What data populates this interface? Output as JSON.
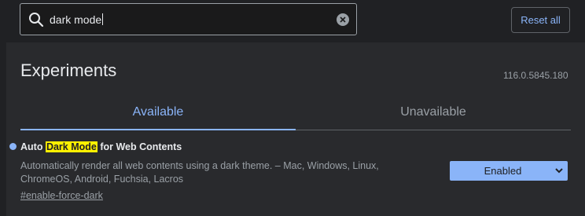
{
  "search": {
    "value": "dark mode"
  },
  "toolbar": {
    "reset_label": "Reset all"
  },
  "page": {
    "title": "Experiments",
    "version": "116.0.5845.180"
  },
  "tabs": [
    {
      "label": "Available"
    },
    {
      "label": "Unavailable"
    }
  ],
  "experiment": {
    "title_prefix": "Auto ",
    "title_highlight": "Dark Mode",
    "title_suffix": " for Web Contents",
    "description_line1": "Automatically render all web contents using a dark theme. – Mac, Windows, Linux,",
    "description_line2": "ChromeOS, Android, Fuchsia, Lacros",
    "link": "#enable-force-dark",
    "selected_option": "Enabled"
  },
  "colors": {
    "accent": "#8ab4f8",
    "highlight": "#fff000",
    "background": "#202124",
    "panel": "#292a2d"
  }
}
